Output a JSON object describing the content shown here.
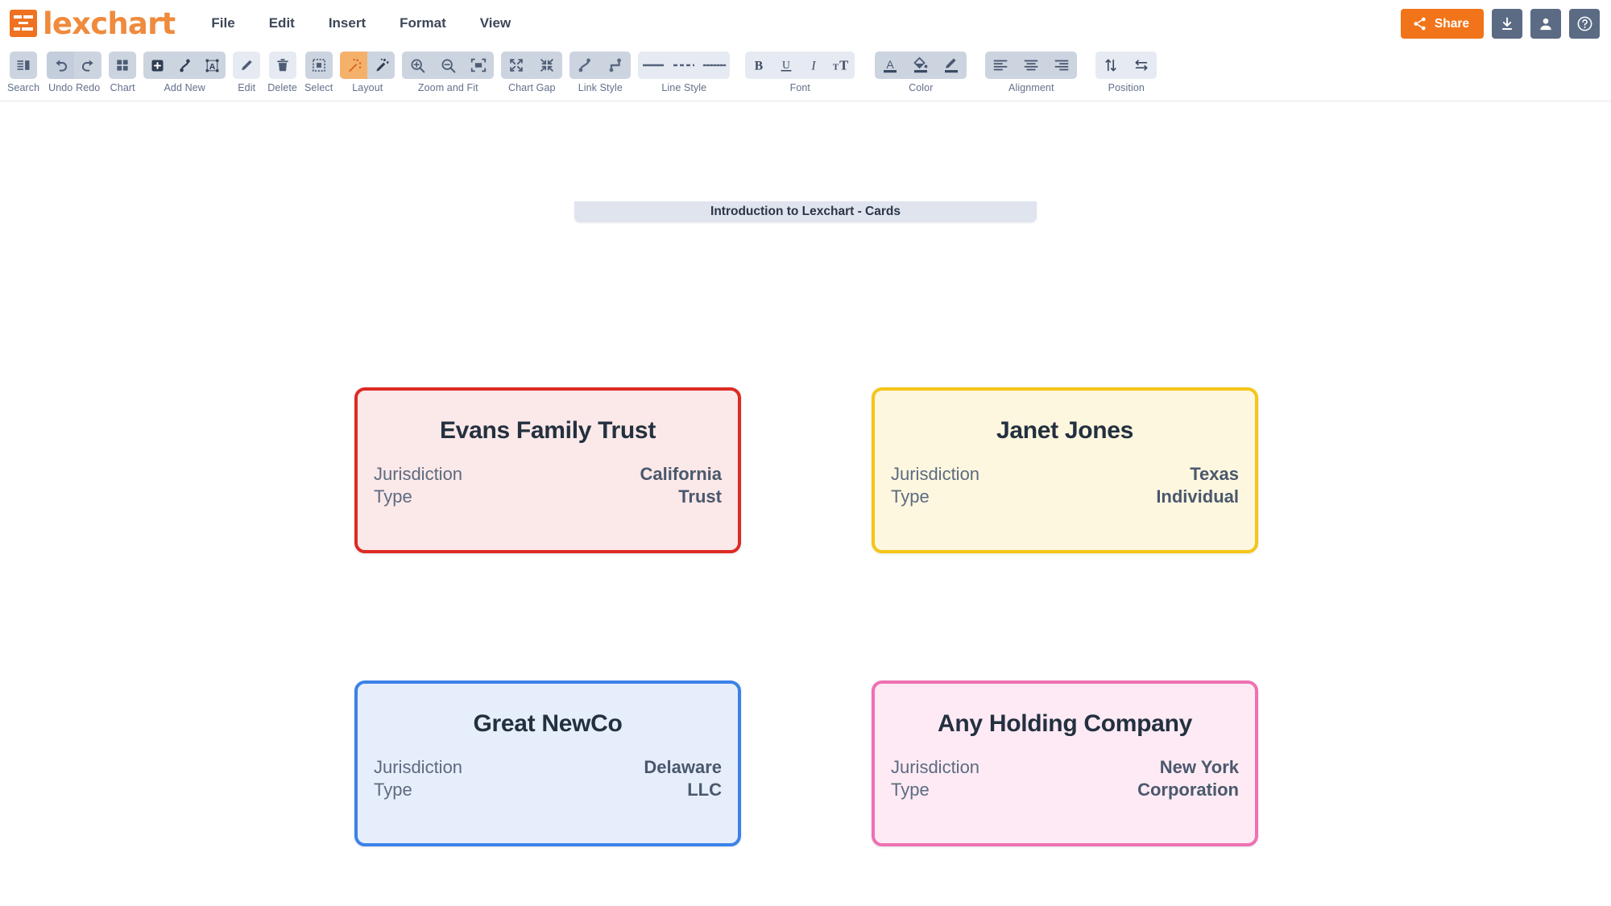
{
  "app": {
    "brand_name": "lexchart",
    "brand_icon": "lexchart-logo-icon"
  },
  "menubar": {
    "items": [
      {
        "label": "File"
      },
      {
        "label": "Edit"
      },
      {
        "label": "Insert"
      },
      {
        "label": "Format"
      },
      {
        "label": "View"
      }
    ]
  },
  "header_actions": {
    "share_label": "Share",
    "share_icon": "share-icon",
    "share_color": "#f2741a",
    "download_icon": "download-icon",
    "account_icon": "user-icon",
    "help_icon": "help-circle-icon"
  },
  "toolbar": {
    "groups": [
      {
        "label": "Search",
        "buttons": [
          {
            "icon": "search-panel-icon"
          }
        ]
      },
      {
        "label": "Undo",
        "buttons": [
          {
            "icon": "undo-icon"
          }
        ]
      },
      {
        "label": "Redo",
        "buttons": [
          {
            "icon": "redo-icon"
          }
        ]
      },
      {
        "label": "Chart",
        "buttons": [
          {
            "icon": "grid-chart-icon"
          }
        ]
      },
      {
        "label": "Add New",
        "buttons": [
          {
            "icon": "add-box-icon"
          },
          {
            "icon": "add-link-icon"
          },
          {
            "icon": "add-textbox-icon"
          }
        ]
      },
      {
        "label": "Edit",
        "buttons": [
          {
            "icon": "pencil-icon"
          }
        ]
      },
      {
        "label": "Delete",
        "buttons": [
          {
            "icon": "trash-icon"
          }
        ]
      },
      {
        "label": "Select",
        "buttons": [
          {
            "icon": "marquee-select-icon"
          }
        ]
      },
      {
        "label": "Layout",
        "buttons": [
          {
            "icon": "magic-wand-icon"
          },
          {
            "icon": "manual-layout-icon"
          }
        ]
      },
      {
        "label": "Zoom and Fit",
        "buttons": [
          {
            "icon": "zoom-in-icon"
          },
          {
            "icon": "zoom-out-icon"
          },
          {
            "icon": "fit-screen-icon"
          }
        ]
      },
      {
        "label": "Chart Gap",
        "buttons": [
          {
            "icon": "expand-gap-icon"
          },
          {
            "icon": "contract-gap-icon"
          }
        ]
      },
      {
        "label": "Link Style",
        "buttons": [
          {
            "icon": "curved-link-icon"
          },
          {
            "icon": "orthogonal-link-icon"
          }
        ]
      },
      {
        "label": "Line Style",
        "buttons": [
          {
            "icon": "solid-line-icon"
          },
          {
            "icon": "dashed-line-icon"
          },
          {
            "icon": "dotted-line-icon"
          }
        ]
      },
      {
        "label": "Font",
        "buttons": [
          {
            "icon": "bold-icon"
          },
          {
            "icon": "underline-icon"
          },
          {
            "icon": "italic-icon"
          },
          {
            "icon": "font-size-icon"
          }
        ]
      },
      {
        "label": "Color",
        "buttons": [
          {
            "icon": "text-color-icon"
          },
          {
            "icon": "fill-color-icon"
          },
          {
            "icon": "line-color-icon"
          }
        ]
      },
      {
        "label": "Alignment",
        "buttons": [
          {
            "icon": "align-left-icon"
          },
          {
            "icon": "align-center-icon"
          },
          {
            "icon": "align-right-icon"
          }
        ]
      },
      {
        "label": "Position",
        "buttons": [
          {
            "icon": "move-vertical-icon"
          },
          {
            "icon": "move-horizontal-icon"
          }
        ]
      }
    ],
    "labels": {
      "search": "Search",
      "undo": "Undo",
      "redo": "Redo",
      "chart": "Chart",
      "add_new": "Add New",
      "edit": "Edit",
      "delete": "Delete",
      "select": "Select",
      "layout": "Layout",
      "zoom_and_fit": "Zoom and Fit",
      "chart_gap": "Chart Gap",
      "link_style": "Link Style",
      "line_style": "Line Style",
      "font": "Font",
      "color": "Color",
      "alignment": "Alignment",
      "position": "Position"
    }
  },
  "document": {
    "tab_title": "Introduction to Lexchart - Cards"
  },
  "chart": {
    "row_keys": {
      "jurisdiction": "Jurisdiction",
      "type": "Type"
    },
    "cards": [
      {
        "title": "Evans Family Trust",
        "jurisdiction_label": "Jurisdiction",
        "jurisdiction_value": "California",
        "type_label": "Type",
        "type_value": "Trust",
        "border_color": "#dd2b24",
        "fill_color": "#fbe8e8"
      },
      {
        "title": "Janet Jones",
        "jurisdiction_label": "Jurisdiction",
        "jurisdiction_value": "Texas",
        "type_label": "Type",
        "type_value": "Individual",
        "border_color": "#f5c518",
        "fill_color": "#fdf7e0"
      },
      {
        "title": "Great NewCo",
        "jurisdiction_label": "Jurisdiction",
        "jurisdiction_value": "Delaware",
        "type_label": "Type",
        "type_value": "LLC",
        "border_color": "#3b82e8",
        "fill_color": "#e7eefb"
      },
      {
        "title": "Any Holding Company",
        "jurisdiction_label": "Jurisdiction",
        "jurisdiction_value": "New York",
        "type_label": "Type",
        "type_value": "Corporation",
        "border_color": "#ee71b3",
        "fill_color": "#fdeaf4"
      }
    ]
  }
}
